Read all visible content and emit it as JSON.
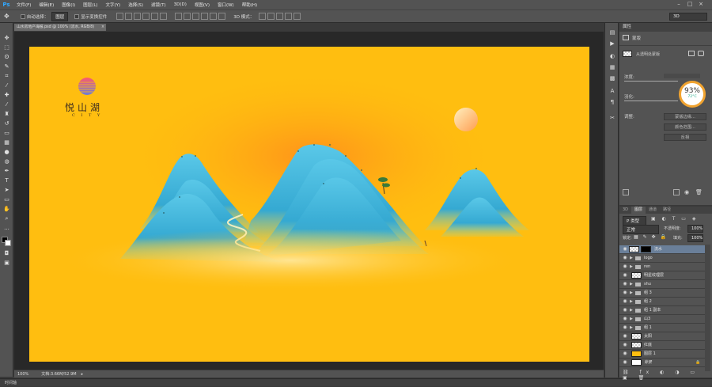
{
  "app": {
    "logo": "Ps",
    "menu": [
      "文件(F)",
      "编辑(E)",
      "图像(I)",
      "图层(L)",
      "文字(Y)",
      "选择(S)",
      "滤镜(T)",
      "3D(D)",
      "视图(V)",
      "窗口(W)",
      "帮助(H)"
    ]
  },
  "options": {
    "auto_select_label": "自动选择：",
    "auto_select_value": "图层",
    "show_transform_label": "显示变换控件",
    "mode_3d_label": "3D 模式：",
    "workspace_value": "3D"
  },
  "document": {
    "tab_title": "山水房地产海报.psd @ 100% (流水, RGB/8)",
    "zoom": "100%",
    "doc_size": "文档:3.66M/52.9M"
  },
  "artwork": {
    "brand_name": "悦山湖",
    "brand_sub": "C I T Y"
  },
  "properties": {
    "panel_title": "属性",
    "mask_label": "蒙版",
    "mask_type": "从透明处蒙版",
    "density_label": "浓度:",
    "feather_label": "羽化:",
    "adjust_label": "调整:",
    "btn_edge": "蒙版边缘...",
    "btn_color": "颜色范围...",
    "btn_invert": "反相"
  },
  "gauge": {
    "value": "93%",
    "sub": "72°C"
  },
  "layers": {
    "tabs": [
      "3D",
      "图层",
      "通道",
      "路径"
    ],
    "filter_value": "P 类型",
    "blend_mode": "正常",
    "opacity_label": "不透明度:",
    "opacity_value": "100%",
    "lock_label": "锁定:",
    "fill_label": "填充:",
    "fill_value": "100%",
    "rows": [
      {
        "name": "流水",
        "type": "layer-mask",
        "selected": true
      },
      {
        "name": "logo",
        "type": "group"
      },
      {
        "name": "ren",
        "type": "group"
      },
      {
        "name": "明星纹理层",
        "type": "pixel"
      },
      {
        "name": "shu",
        "type": "group"
      },
      {
        "name": "组 3",
        "type": "group"
      },
      {
        "name": "组 2",
        "type": "group"
      },
      {
        "name": "组 1 副本",
        "type": "group"
      },
      {
        "name": "山3",
        "type": "group"
      },
      {
        "name": "组 1",
        "type": "group"
      },
      {
        "name": "太阳",
        "type": "pixel"
      },
      {
        "name": "红底",
        "type": "pixel"
      },
      {
        "name": "图层 1",
        "type": "yellow"
      },
      {
        "name": "背景",
        "type": "white"
      }
    ]
  },
  "timeline": {
    "label": "时间轴"
  },
  "colors": {
    "canvas_bg": "#ffbe10",
    "mountain": "#3fb4d8",
    "accent": "#31a8ff"
  }
}
